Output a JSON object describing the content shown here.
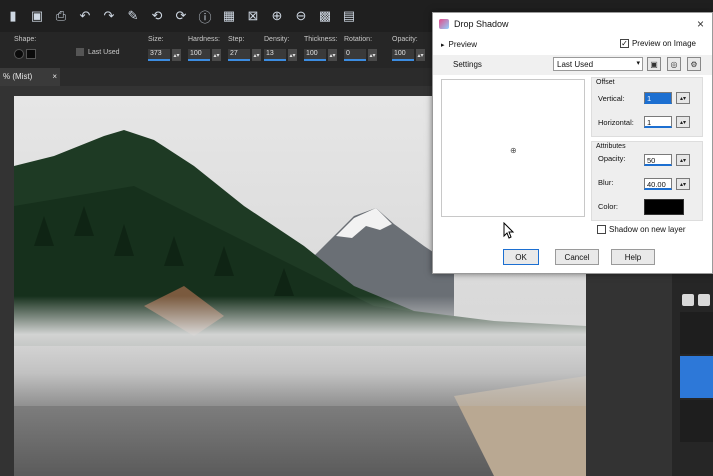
{
  "toolbar_icons": [
    "rectangle-select-icon",
    "save-icon",
    "print-icon",
    "undo-icon",
    "redo-icon",
    "edit-selection-icon",
    "back-icon",
    "forward-icon",
    "info-icon",
    "fit-window-icon",
    "fit-image-icon",
    "zoom-in-icon",
    "zoom-out-icon",
    "grid-icon",
    "layers-icon"
  ],
  "tool_options": {
    "shape_label": "Shape:",
    "last_used_label": "Last Used",
    "size_label": "Size:",
    "size_value": "373",
    "hardness_label": "Hardness:",
    "hardness_value": "100",
    "step_label": "Step:",
    "step_value": "27",
    "density_label": "Density:",
    "density_value": "13",
    "thickness_label": "Thickness:",
    "thickness_value": "100",
    "rotation_label": "Rotation:",
    "rotation_value": "0",
    "opacity_label": "Opacity:",
    "opacity_value": "100"
  },
  "doc_tab": {
    "label": "% (Mist)",
    "close": "×"
  },
  "colors": {
    "accent": "#1c6fd1",
    "app_bg": "#2b2b2b",
    "selection": "#2d78d8"
  },
  "dialog": {
    "title": "Drop Shadow",
    "close": "×",
    "preview_label": "Preview",
    "preview_on_image_label": "Preview on Image",
    "preview_on_image_checked": true,
    "settings_label": "Settings",
    "preset_value": "Last Used",
    "offset": {
      "title": "Offset",
      "vertical_label": "Vertical:",
      "vertical_value": "1",
      "horizontal_label": "Horizontal:",
      "horizontal_value": "1"
    },
    "attributes": {
      "title": "Attributes",
      "opacity_label": "Opacity:",
      "opacity_value": "50",
      "blur_label": "Blur:",
      "blur_value": "40.00",
      "color_label": "Color:",
      "color_value": "#000000"
    },
    "shadow_new_layer_label": "Shadow on new layer",
    "shadow_new_layer_checked": false,
    "ok_label": "OK",
    "cancel_label": "Cancel",
    "help_label": "Help"
  }
}
